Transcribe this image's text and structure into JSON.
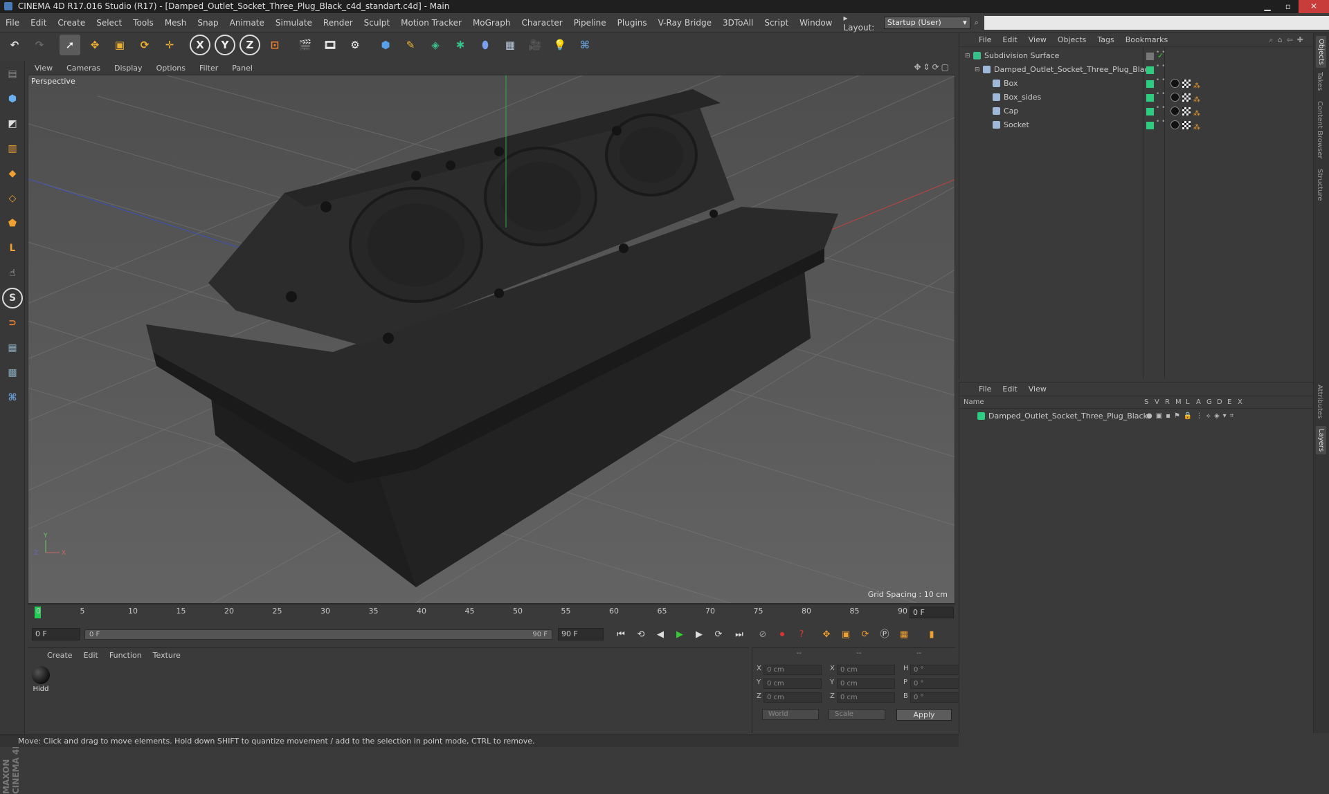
{
  "window": {
    "title": "CINEMA 4D R17.016 Studio (R17) - [Damped_Outlet_Socket_Three_Plug_Black_c4d_standart.c4d] - Main"
  },
  "menubar": {
    "items": [
      "File",
      "Edit",
      "Create",
      "Select",
      "Tools",
      "Mesh",
      "Snap",
      "Animate",
      "Simulate",
      "Render",
      "Sculpt",
      "Motion Tracker",
      "MoGraph",
      "Character",
      "Pipeline",
      "Plugins",
      "V-Ray Bridge",
      "3DToAll",
      "Script",
      "Window"
    ],
    "layout_label": "Layout:",
    "layout_value": "Startup (User)"
  },
  "viewport": {
    "menu": [
      "View",
      "Cameras",
      "Display",
      "Options",
      "Filter",
      "Panel"
    ],
    "label": "Perspective",
    "grid_spacing": "Grid Spacing : 10 cm"
  },
  "timeline": {
    "ticks": [
      "0",
      "5",
      "10",
      "15",
      "20",
      "25",
      "30",
      "35",
      "40",
      "45",
      "50",
      "55",
      "60",
      "65",
      "70",
      "75",
      "80",
      "85",
      "90"
    ],
    "current_frame": "0 F",
    "start_field": "0 F",
    "slider_start": "0 F",
    "slider_end": "90 F",
    "end_field": "90 F"
  },
  "material_panel": {
    "menu": [
      "Create",
      "Edit",
      "Function",
      "Texture"
    ],
    "materials": [
      {
        "name": "Hidd"
      }
    ]
  },
  "coordinates": {
    "headers": [
      "--",
      "--",
      "--"
    ],
    "rows": [
      {
        "l1": "X",
        "v1": "0 cm",
        "l2": "X",
        "v2": "0 cm",
        "l3": "H",
        "v3": "0 °"
      },
      {
        "l1": "Y",
        "v1": "0 cm",
        "l2": "Y",
        "v2": "0 cm",
        "l3": "P",
        "v3": "0 °"
      },
      {
        "l1": "Z",
        "v1": "0 cm",
        "l2": "Z",
        "v2": "0 cm",
        "l3": "B",
        "v3": "0 °"
      }
    ],
    "space": "World",
    "mode": "Scale",
    "apply": "Apply"
  },
  "object_manager": {
    "menu": [
      "File",
      "Edit",
      "View",
      "Objects",
      "Tags",
      "Bookmarks"
    ],
    "objects": [
      {
        "name": "Subdivision Surface",
        "depth": 0,
        "icon_color": "#37c08a"
      },
      {
        "name": "Damped_Outlet_Socket_Three_Plug_Black",
        "depth": 1,
        "icon_color": "#9fb7d8"
      },
      {
        "name": "Box",
        "depth": 2,
        "icon_color": "#9fb7d8"
      },
      {
        "name": "Box_sides",
        "depth": 2,
        "icon_color": "#9fb7d8"
      },
      {
        "name": "Cap",
        "depth": 2,
        "icon_color": "#9fb7d8"
      },
      {
        "name": "Socket",
        "depth": 2,
        "icon_color": "#9fb7d8"
      }
    ]
  },
  "layer_manager": {
    "menu": [
      "File",
      "Edit",
      "View"
    ],
    "columns": [
      "Name",
      "S",
      "V",
      "R",
      "M",
      "L",
      "A",
      "G",
      "D",
      "E",
      "X"
    ],
    "layers": [
      {
        "name": "Damped_Outlet_Socket_Three_Plug_Black",
        "color": "#2ecc80"
      }
    ]
  },
  "right_tabs": [
    "Objects",
    "Takes",
    "Content Browser",
    "Structure",
    "Attributes",
    "Layers"
  ],
  "status": "Move: Click and drag to move elements. Hold down SHIFT to quantize movement / add to the selection in point mode, CTRL to remove.",
  "brand": "MAXON CINEMA 4D",
  "colors": {
    "accent_green": "#2ecc80",
    "toolbar_blue": "#3f6fa8"
  }
}
